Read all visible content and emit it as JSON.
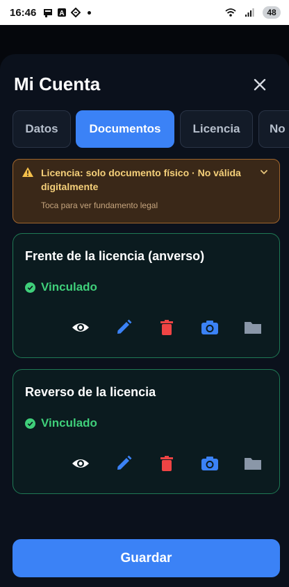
{
  "status_bar": {
    "time": "16:46",
    "battery": "48",
    "icons": [
      "notification-icon",
      "a-icon",
      "location-icon",
      "wifi-icon",
      "signal-icon"
    ]
  },
  "sheet": {
    "title": "Mi Cuenta",
    "close_icon": "close-icon"
  },
  "tabs": [
    {
      "label": "Datos",
      "active": false
    },
    {
      "label": "Documentos",
      "active": true
    },
    {
      "label": "Licencia",
      "active": false
    },
    {
      "label": "No",
      "active": false
    }
  ],
  "alert": {
    "message": "Licencia: solo documento físico · No válida digitalmente",
    "hint": "Toca para ver fundamento legal",
    "icon": "warning-icon",
    "expand_icon": "chevron-down-icon"
  },
  "documents": [
    {
      "title": "Frente de la licencia (anverso)",
      "status": "Vinculado",
      "actions": [
        "view-icon",
        "edit-icon",
        "delete-icon",
        "camera-icon",
        "folder-icon"
      ]
    },
    {
      "title": "Reverso de la licencia",
      "status": "Vinculado",
      "actions": [
        "view-icon",
        "edit-icon",
        "delete-icon",
        "camera-icon",
        "folder-icon"
      ]
    }
  ],
  "footer": {
    "save_label": "Guardar"
  },
  "colors": {
    "accent": "#3b82f6",
    "success": "#3fcf7a",
    "danger": "#ef4444",
    "warning": "#f5c04a",
    "folder": "#8a97a8"
  }
}
